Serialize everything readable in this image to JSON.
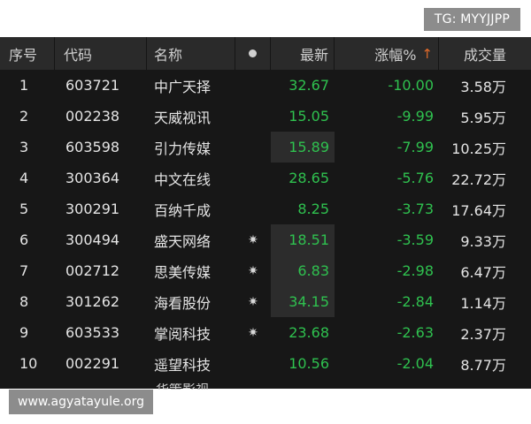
{
  "watermark_top": "TG: MYYJJPP",
  "watermark_bottom": "www.agyatayule.org",
  "header": {
    "index": "序号",
    "code": "代码",
    "name": "名称",
    "mark": "●",
    "price": "最新",
    "change_pct": "涨幅%",
    "sort_arrow": "↑",
    "volume": "成交量"
  },
  "rows": [
    {
      "index": "1",
      "code": "603721",
      "name": "中广天择",
      "mark": "",
      "price": "32.67",
      "change_pct": "-10.00",
      "volume": "3.58万"
    },
    {
      "index": "2",
      "code": "002238",
      "name": "天威视讯",
      "mark": "",
      "price": "15.05",
      "change_pct": "-9.99",
      "volume": "5.95万"
    },
    {
      "index": "3",
      "code": "603598",
      "name": "引力传媒",
      "mark": "",
      "price": "15.89",
      "change_pct": "-7.99",
      "volume": "10.25万"
    },
    {
      "index": "4",
      "code": "300364",
      "name": "中文在线",
      "mark": "",
      "price": "28.65",
      "change_pct": "-5.76",
      "volume": "22.72万"
    },
    {
      "index": "5",
      "code": "300291",
      "name": "百纳千成",
      "mark": "",
      "price": "8.25",
      "change_pct": "-3.73",
      "volume": "17.64万"
    },
    {
      "index": "6",
      "code": "300494",
      "name": "盛天网络",
      "mark": "✷",
      "price": "18.51",
      "change_pct": "-3.59",
      "volume": "9.33万"
    },
    {
      "index": "7",
      "code": "002712",
      "name": "思美传媒",
      "mark": "✷",
      "price": "6.83",
      "change_pct": "-2.98",
      "volume": "6.47万"
    },
    {
      "index": "8",
      "code": "301262",
      "name": "海看股份",
      "mark": "✷",
      "price": "34.15",
      "change_pct": "-2.84",
      "volume": "1.14万"
    },
    {
      "index": "9",
      "code": "603533",
      "name": "掌阅科技",
      "mark": "✷",
      "price": "23.68",
      "change_pct": "-2.63",
      "volume": "2.37万"
    },
    {
      "index": "10",
      "code": "002291",
      "name": "遥望科技",
      "mark": "",
      "price": "10.56",
      "change_pct": "-2.04",
      "volume": "8.77万"
    }
  ],
  "next_row_name_peek": "华策影视",
  "colors": {
    "background": "#171717",
    "header_bg": "#2a2a2a",
    "down_green": "#2fc14f",
    "sort_arrow": "#e06a2a",
    "watermark_bg": "#8c8c8c"
  }
}
